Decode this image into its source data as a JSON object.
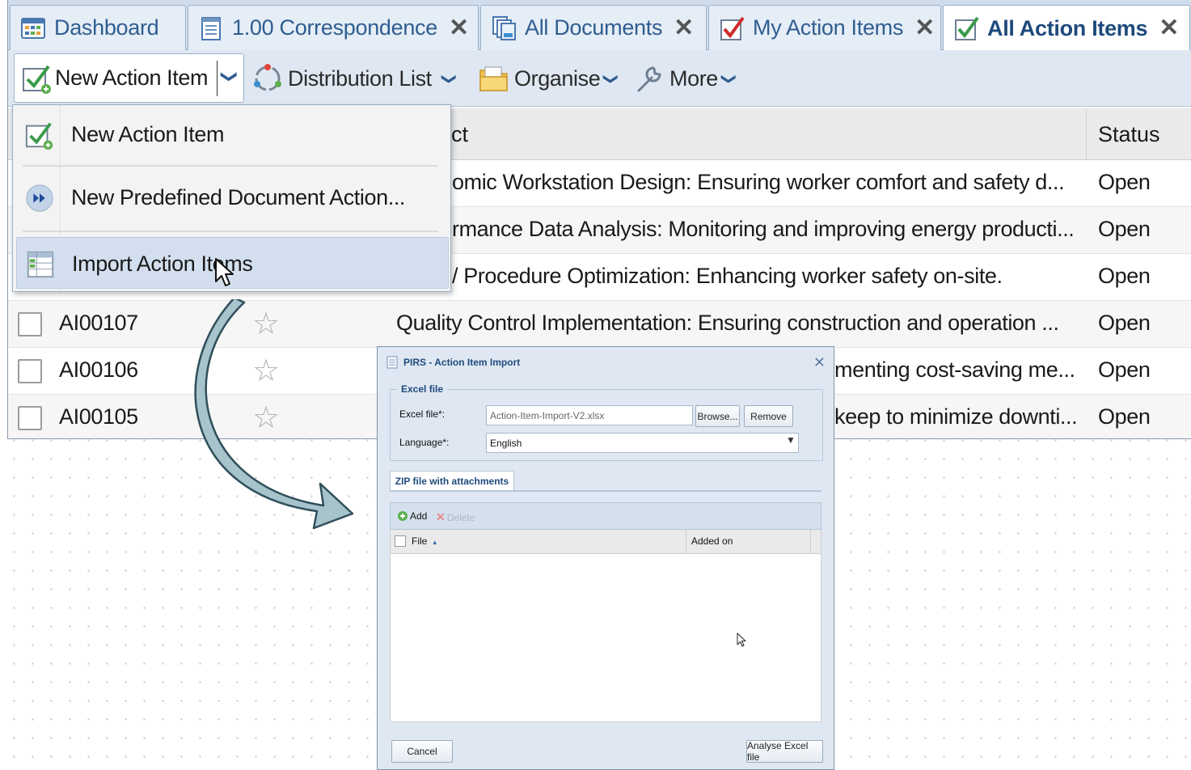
{
  "tabs": [
    {
      "label": "Dashboard",
      "icon": "dashboard-icon",
      "closable": false,
      "active": false
    },
    {
      "label": "1.00 Correspondence",
      "icon": "document-list-icon",
      "closable": true,
      "active": false
    },
    {
      "label": "All Documents",
      "icon": "documents-stack-icon",
      "closable": true,
      "active": false
    },
    {
      "label": "My Action Items",
      "icon": "checkbox-red-tick-icon",
      "closable": true,
      "active": false
    },
    {
      "label": "All Action Items",
      "icon": "checkbox-green-tick-icon",
      "closable": true,
      "active": true
    }
  ],
  "toolbar": {
    "new_action_item": "New Action Item",
    "distribution_list": "Distribution List",
    "organise": "Organise",
    "more": "More"
  },
  "menu": {
    "items": [
      {
        "label": "New Action Item",
        "icon": "new-action-item-icon"
      },
      {
        "label": "New Predefined Document Action...",
        "icon": "fast-forward-icon"
      },
      {
        "label": "Import Action Items",
        "icon": "import-table-icon"
      }
    ]
  },
  "grid": {
    "columns": {
      "subject": "ct",
      "status": "Status"
    },
    "rows": [
      {
        "id": "",
        "subject": "omic Workstation Design: Ensuring worker comfort and safety d...",
        "status": "Open"
      },
      {
        "id": "",
        "subject": "rmance Data Analysis: Monitoring and improving energy producti...",
        "status": "Open"
      },
      {
        "id": "",
        "subject": "/ Procedure Optimization: Enhancing worker safety on-site.",
        "status": "Open"
      },
      {
        "id": "AI00107",
        "subject": "Quality Control Implementation: Ensuring construction and operation ...",
        "status": "Open"
      },
      {
        "id": "AI00106",
        "subject": "menting cost-saving me...",
        "status": "Open"
      },
      {
        "id": "AI00105",
        "subject": "keep to minimize downti...",
        "status": "Open"
      }
    ]
  },
  "dialog": {
    "title": "PIRS - Action Item Import",
    "excel_legend": "Excel file",
    "excel_file_label": "Excel file*:",
    "excel_file_value": "Action-Item-Import-V2.xlsx",
    "browse": "Browse...",
    "remove": "Remove",
    "language_label": "Language*:",
    "language_value": "English",
    "zip_tab": "ZIP file with attachments",
    "add": "Add",
    "delete": "Delete",
    "col_file": "File",
    "col_added_on": "Added on",
    "cancel": "Cancel",
    "analyse": "Analyse Excel file"
  },
  "colors": {
    "tab_text": "#2f5d91",
    "toolbar_bg": "#dfe8f2",
    "menu_hover": "#d3dfee",
    "arrow_fill": "#a7c3cc"
  }
}
